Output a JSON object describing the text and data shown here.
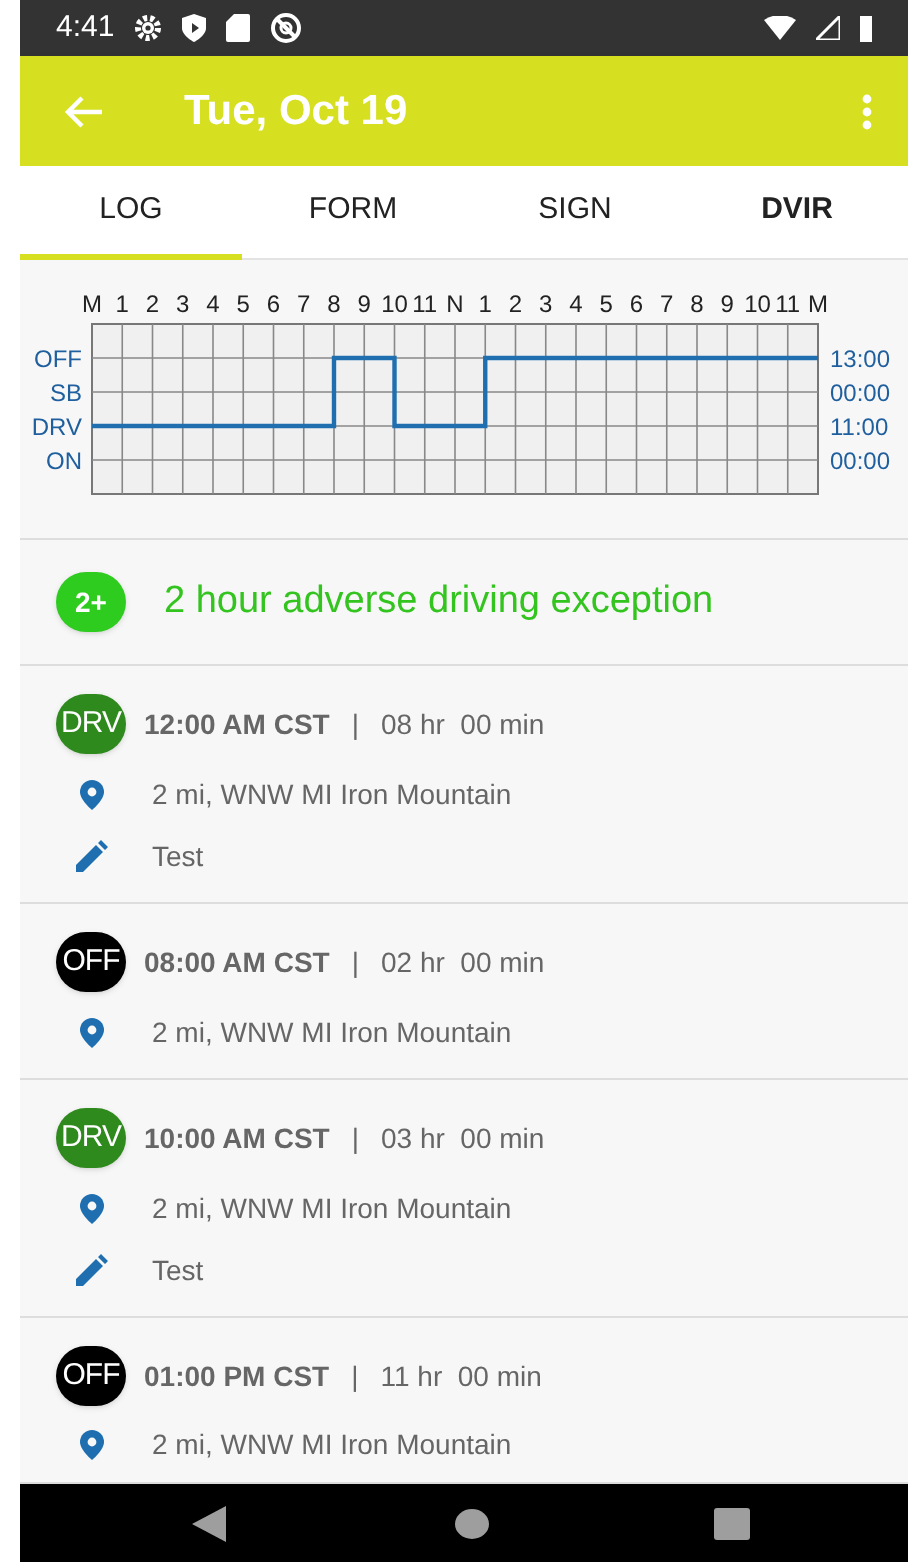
{
  "status_bar": {
    "time": "4:41"
  },
  "app_bar": {
    "title": "Tue, Oct 19"
  },
  "tabs": [
    {
      "label": "LOG",
      "selected": true
    },
    {
      "label": "FORM",
      "selected": false
    },
    {
      "label": "SIGN",
      "selected": false
    },
    {
      "label": "DVIR",
      "selected": false
    }
  ],
  "log_graph": {
    "hour_labels": [
      "M",
      "1",
      "2",
      "3",
      "4",
      "5",
      "6",
      "7",
      "8",
      "9",
      "10",
      "11",
      "N",
      "1",
      "2",
      "3",
      "4",
      "5",
      "6",
      "7",
      "8",
      "9",
      "10",
      "11",
      "M"
    ],
    "status_labels": [
      "OFF",
      "SB",
      "DRV",
      "ON"
    ],
    "totals": [
      "13:00",
      "00:00",
      "11:00",
      "00:00"
    ]
  },
  "exception": {
    "badge": "2+",
    "text": "2 hour adverse driving exception"
  },
  "entries": [
    {
      "status": "DRV",
      "time": "12:00 AM CST",
      "separator": "|",
      "duration": "08 hr  00 min",
      "location": "2 mi, WNW MI Iron Mountain",
      "note": "Test"
    },
    {
      "status": "OFF",
      "time": "08:00 AM CST",
      "separator": "|",
      "duration": "02 hr  00 min",
      "location": "2 mi, WNW MI Iron Mountain"
    },
    {
      "status": "DRV",
      "time": "10:00 AM CST",
      "separator": "|",
      "duration": "03 hr  00 min",
      "location": "2 mi, WNW MI Iron Mountain",
      "note": "Test"
    },
    {
      "status": "OFF",
      "time": "01:00 PM CST",
      "separator": "|",
      "duration": "11 hr  00 min",
      "location": "2 mi, WNW MI Iron Mountain"
    }
  ]
}
